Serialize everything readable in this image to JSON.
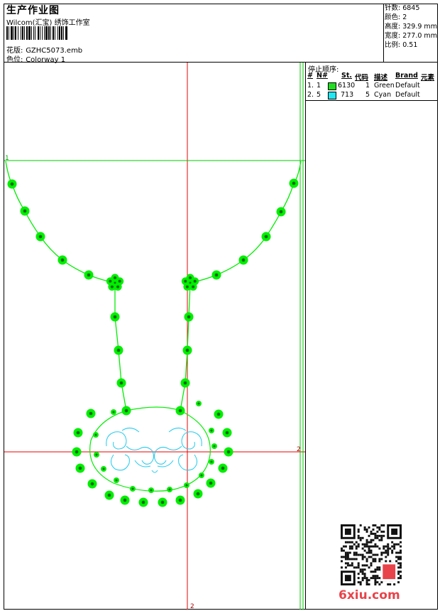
{
  "header": {
    "title": "生产作业图",
    "studio": "Wilcom(汇宝) 绣饰工作室",
    "design_label": "花版:",
    "design_value": "GZHC5073.emb",
    "colorway_label": "色位:",
    "colorway_value": "Colorway 1"
  },
  "stats": {
    "stitches": "针数: 6845",
    "colors": "颜色: 2",
    "height": "高度: 329.9 mm",
    "width": "宽度: 277.0 mm",
    "scale": "比例: 0.51"
  },
  "stop_sequence": {
    "title": "停止顺序:",
    "headers": [
      "#",
      "N#",
      "St.",
      "代码",
      "描述",
      "Brand",
      "元素"
    ],
    "rows": [
      {
        "idx": "1.",
        "needle": "1",
        "stitches": "6130",
        "code": "1",
        "desc": "Green",
        "brand": "Default",
        "color": "#22dd22"
      },
      {
        "idx": "2.",
        "needle": "5",
        "stitches": "713",
        "code": "5",
        "desc": "Cyan",
        "brand": "Default",
        "color": "#22e6f0"
      }
    ]
  },
  "canvas": {
    "marker_start": "1",
    "marker_end_h": "2",
    "marker_end_v": "2",
    "green": "#00ee00",
    "cyan": "#22ccee",
    "guide_red": "#ee0000"
  },
  "footer": {
    "brand": "6xiu.com"
  }
}
